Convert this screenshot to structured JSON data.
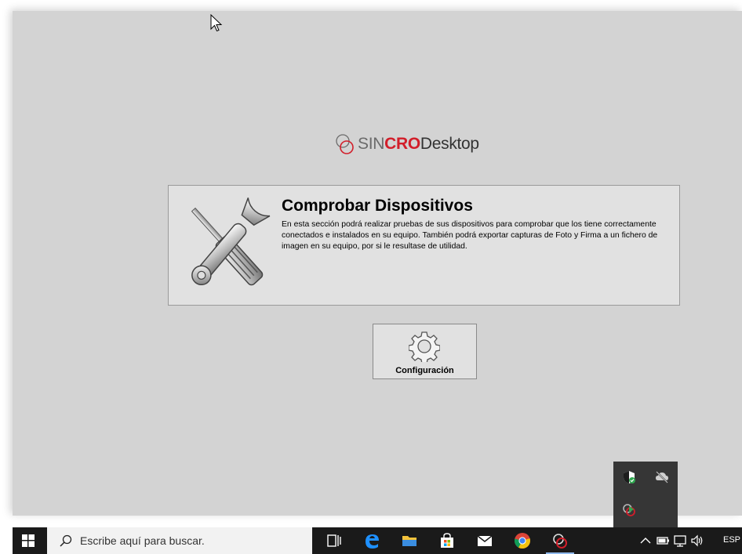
{
  "app": {
    "logo": {
      "sin": "SIN",
      "cro": "CRO",
      "desktop": "Desktop"
    },
    "card": {
      "title": "Comprobar Dispositivos",
      "description": "En esta sección podrá realizar pruebas de sus dispositivos para comprobar que los tiene correctamente conectados e instalados en su equipo. También podrá exportar capturas de Foto y Firma a un fichero de imagen en su equipo, por si le resultase de utilidad."
    },
    "config_button": {
      "label": "Configuración"
    }
  },
  "taskbar": {
    "search": {
      "placeholder": "Escribe aquí para buscar."
    },
    "pinned": [
      {
        "name": "task-view-icon"
      },
      {
        "name": "edge-icon"
      },
      {
        "name": "file-explorer-icon"
      },
      {
        "name": "store-icon"
      },
      {
        "name": "mail-icon"
      },
      {
        "name": "chrome-icon"
      },
      {
        "name": "sincro-icon"
      }
    ],
    "tray": {
      "language": "ESP"
    }
  },
  "tray_flyout": {
    "icons": [
      "defender-icon",
      "onedrive-offline-icon",
      "sincro-tray-icon"
    ]
  },
  "colors": {
    "window_bg": "#d3d3d3",
    "card_bg": "#e1e1e1",
    "brand_red": "#d21e2a",
    "taskbar_bg": "#1a1a1a"
  }
}
